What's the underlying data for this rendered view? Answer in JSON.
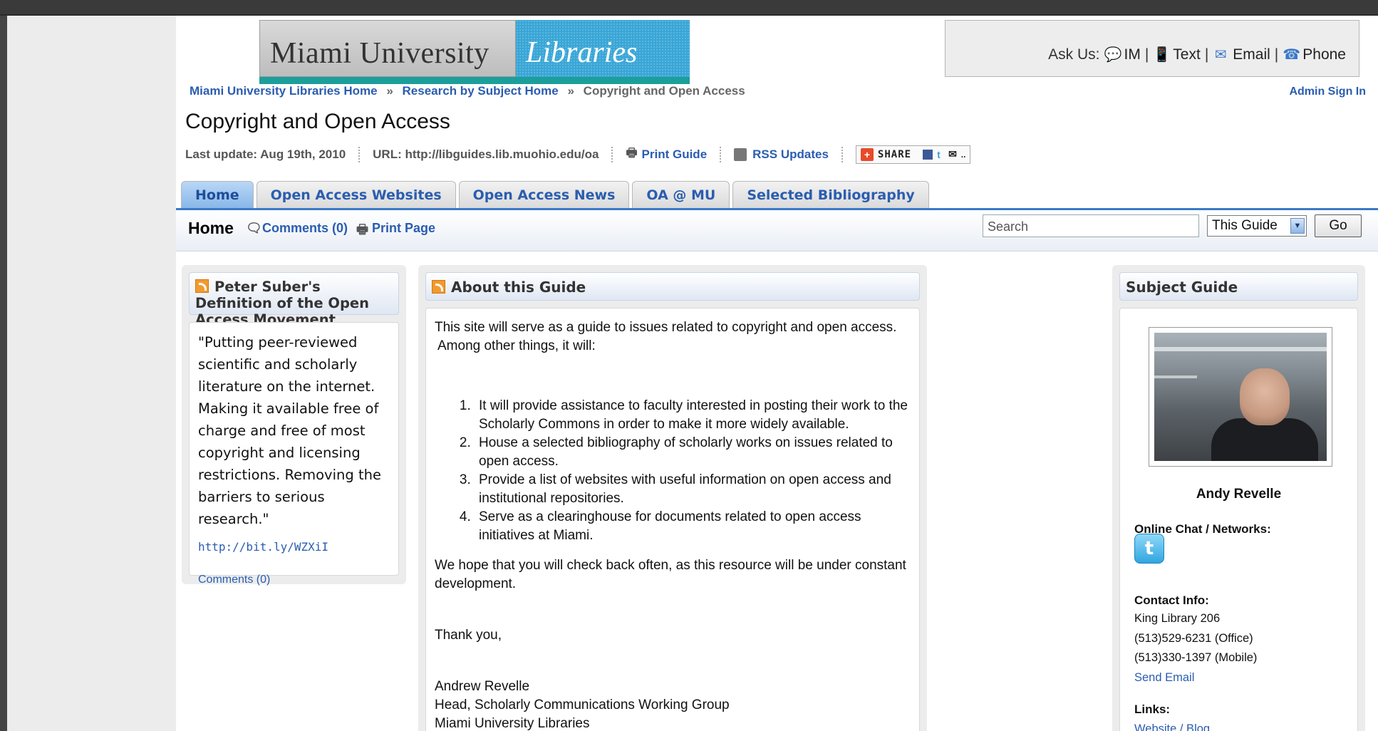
{
  "header": {
    "logo_left": "Miami University",
    "logo_right": "Libraries",
    "ask_us": {
      "label": "Ask Us:",
      "im": "IM",
      "text": "Text",
      "email": "Email",
      "phone": "Phone",
      "sep": "|"
    }
  },
  "breadcrumb": {
    "items": [
      "Miami University Libraries Home",
      "Research by Subject Home",
      "Copyright and Open Access"
    ],
    "sep": "»"
  },
  "admin_sign_in": "Admin Sign In",
  "page_title": "Copyright and Open Access",
  "meta": {
    "last_update": "Last update: Aug 19th, 2010",
    "url": "URL: http://libguides.lib.muohio.edu/oa",
    "print_guide": "Print Guide",
    "rss_updates": "RSS Updates",
    "share": "SHARE"
  },
  "tabs": [
    {
      "label": "Home",
      "active": true
    },
    {
      "label": "Open Access Websites",
      "active": false
    },
    {
      "label": "Open Access News",
      "active": false
    },
    {
      "label": "OA @ MU",
      "active": false
    },
    {
      "label": "Selected Bibliography",
      "active": false
    }
  ],
  "subbar": {
    "current": "Home",
    "comments": "Comments (0)",
    "print_page": "Print Page",
    "search_placeholder": "Search",
    "scope": "This Guide",
    "go": "Go"
  },
  "left_box": {
    "title": "Peter Suber's Definition of the Open Access Movement",
    "quote": "\"Putting peer-reviewed scientific and scholarly literature on the internet. Making it available free of charge and free of most copyright and licensing restrictions. Removing the barriers to serious research.\"",
    "link": "http://bit.ly/WZXiI",
    "comments": "Comments (0)"
  },
  "center_box": {
    "title": "About this Guide",
    "intro": "This site will serve as a guide to issues related to copyright and open access.",
    "intro2": "Among other things, it will:",
    "list": [
      "It will provide assistance to faculty interested in posting their work to the Scholarly Commons in order to make it more widely available.",
      "House a selected bibliography of scholarly works on issues related to open access.",
      "Provide a list of websites with useful information on open access and institutional repositories.",
      "Serve as a clearinghouse for documents related to open access initiatives at Miami."
    ],
    "closing": "We hope that you will check back often, as this resource will be under constant development.",
    "thanks": "Thank you,",
    "sig_name": "Andrew Revelle",
    "sig_title": "Head, Scholarly Communications Working Group",
    "sig_org": "Miami University Libraries"
  },
  "right_box": {
    "title": "Subject Guide",
    "name": "Andy Revelle",
    "online_label": "Online Chat / Networks:",
    "contact_label": "Contact Info:",
    "contact": [
      "King Library 206",
      "(513)529-6231 (Office)",
      "(513)330-1397 (Mobile)"
    ],
    "send_email": "Send Email",
    "links_label": "Links:",
    "links_value": "Website / Blog"
  }
}
